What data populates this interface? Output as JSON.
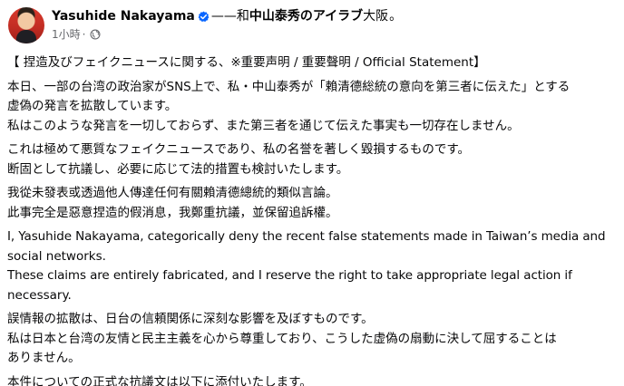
{
  "post": {
    "author": "Yasuhide Nakayama",
    "with_text": "——和",
    "page_name": "中山泰秀のアイラブ",
    "location": "大阪",
    "trailing_dot": "。",
    "time": "1小時",
    "sub_dot": "·",
    "verified_color": "#0866ff",
    "icons": {
      "verified": "verified-badge-icon",
      "audience": "globe-icon"
    },
    "lines": [
      "【 捏造及びフェイクニュースに関する、※重要声明 / 重要聲明 / Official Statement】",
      "本日、一部の台湾の政治家がSNS上で、私・中山泰秀が「賴清德総統の意向を第三者に伝えた」とする",
      "虚偽の発言を拡散しています。",
      "私はこのような発言を一切しておらず、また第三者を通じて伝えた事実も一切存在しません。",
      "これは極めて悪質なフェイクニュースであり、私の名誉を著しく毀損するものです。",
      "断固として抗議し、必要に応じて法的措置も検討いたします。",
      "我從未發表或透過他人傳達任何有關賴清德總統的類似言論。",
      "此事完全是惡意捏造的假消息，我鄭重抗議，並保留追訴權。",
      "I, Yasuhide Nakayama, categorically deny the recent false statements made in Taiwan’s media and",
      "social networks.",
      "These claims are entirely fabricated, and I reserve the right to take appropriate legal action if",
      "necessary.",
      "誤情報の拡散は、日台の信頼関係に深刻な影響を及ぼすものです。",
      "私は日本と台湾の友情と民主主義を心から尊重しており、こうした虚偽の扇動に決して屈することは",
      "ありません。",
      "本件についての正式な抗議文は以下に添付いたします。"
    ]
  }
}
